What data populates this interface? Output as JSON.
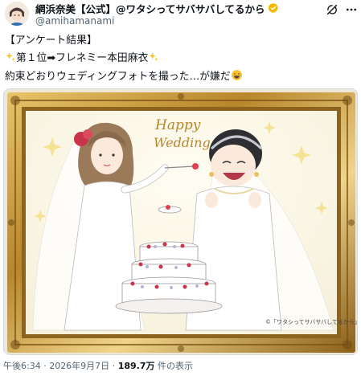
{
  "post": {
    "display_name": "網浜奈美【公式】@ワタシってサバサバしてるから",
    "handle": "@amihamanami",
    "line1": "【アンケート結果】",
    "line2": "第１位➡フレネミー本田麻衣",
    "line3": "約束どおりウェディングフォトを撮った…が嫌だ",
    "image_title": "Happy Wedding",
    "image_credit": "©「ワタシってサバサバしてるから」",
    "time": "午後6:34 · 2026年9月7日 · ",
    "views": "189.7万",
    "views_label": " 件の表示"
  },
  "icons": [
    "avatar",
    "verified-badge-icon",
    "grok-icon",
    "more-icon",
    "sparkles-emoji",
    "laughing-emoji"
  ],
  "colors": {
    "verified": "#f5b800",
    "accent": "#1d9bf0",
    "frame_gold": "#b8862b"
  }
}
